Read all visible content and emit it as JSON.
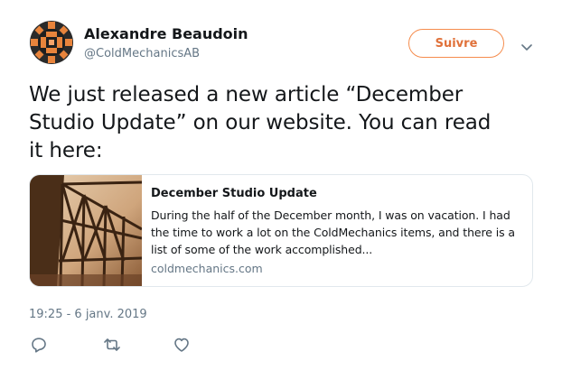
{
  "author": {
    "name": "Alexandre Beaudoin",
    "handle": "@ColdMechanicsAB"
  },
  "follow_button": {
    "label": "Suivre"
  },
  "tweet": {
    "text_lines": [
      "We just released a new article “December",
      "Studio Update” on our website. You can read",
      "it here:"
    ]
  },
  "card": {
    "title": "December Studio Update",
    "description_lines": [
      "During the half of the December month, I was on vacation. I had",
      "the time to work a lot on the ColdMechanics items, and there is a",
      "list of some of the work accomplished..."
    ],
    "domain": "coldmechanics.com"
  },
  "timestamp": "19:25 - 6 janv. 2019",
  "actions": [
    {
      "icon": "reply-icon"
    },
    {
      "icon": "retweet-icon"
    },
    {
      "icon": "like-icon"
    }
  ],
  "colors": {
    "accent": "#f58c4d",
    "text": "#14171a",
    "secondary": "#657786",
    "border": "#e1e8ed"
  }
}
